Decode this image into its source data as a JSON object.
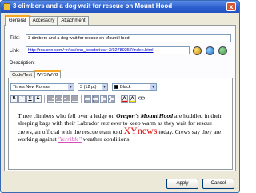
{
  "window": {
    "title": "3 climbers and a dog wait for rescue on Mount Hood",
    "close_glyph": "x"
  },
  "tabs": [
    {
      "label": "General",
      "active": true
    },
    {
      "label": "Accessory",
      "active": false
    },
    {
      "label": "Attachment",
      "active": false
    }
  ],
  "form": {
    "title_label": "Title:",
    "title_value": "3 dimbers and a dog wait for rescue on Mount Hood",
    "link_label": "Link:",
    "link_value": "http://rss.cnn.com/~r/rss/cnn_topstories/~3/92780257/index.html",
    "description_label": "Description:"
  },
  "editor_tabs": [
    {
      "label": "Code/Text",
      "active": false
    },
    {
      "label": "WYSIWYG",
      "active": true
    }
  ],
  "toolbar": {
    "font": "Times New Roman",
    "size": "3 (12 pt)",
    "color": "Black",
    "color_hex": "#000000",
    "buttons": [
      "B",
      "I",
      "U",
      "S"
    ]
  },
  "content": {
    "p1": "Three climbers who fell over a ledge on ",
    "p1_emph": "Oregon's Mount Hood",
    "p2": " are huddled in their sleeping bags with their Labrador retriever to keep warm as they wait for rescue crews, an official with the rescue team told ",
    "p2_brand": "XYnews",
    "p3": " today. Crews say they are working against ",
    "p3_link": "\"terrible\"",
    "p4": " weather conditions."
  },
  "buttons": {
    "apply": "Apply",
    "cancel": "Cancel"
  },
  "colors": {
    "titlebar": "#2a5ccc",
    "accent_tab": "#f5a623",
    "brand_red": "#e01010",
    "link_pink": "#d64bb5"
  }
}
